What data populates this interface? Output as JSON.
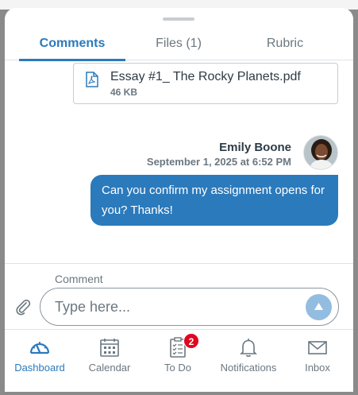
{
  "tabs": [
    {
      "label": "Comments",
      "active": true
    },
    {
      "label": "Files (1)",
      "active": false
    },
    {
      "label": "Rubric",
      "active": false
    }
  ],
  "attachment": {
    "icon": "pdf-file-icon",
    "filename": "Essay #1_ The Rocky Planets.pdf",
    "size": "46 KB"
  },
  "message": {
    "author": "Emily Boone",
    "timestamp": "September 1, 2025 at 6:52 PM",
    "text": "Can you confirm my assignment opens for you? Thanks!"
  },
  "composer": {
    "label": "Comment",
    "placeholder": "Type here...",
    "attach_icon": "paperclip-icon",
    "send_icon": "arrow-up-icon"
  },
  "nav": {
    "items": [
      {
        "label": "Dashboard",
        "icon": "dashboard-gauge-icon",
        "active": true
      },
      {
        "label": "Calendar",
        "icon": "calendar-icon",
        "active": false
      },
      {
        "label": "To Do",
        "icon": "clipboard-checklist-icon",
        "active": false,
        "badge": "2"
      },
      {
        "label": "Notifications",
        "icon": "bell-icon",
        "active": false
      },
      {
        "label": "Inbox",
        "icon": "envelope-icon",
        "active": false
      }
    ]
  },
  "colors": {
    "accent": "#2b7abc",
    "bubble": "#2b7abc",
    "badge": "#e0061f",
    "send_button": "#93bde0"
  }
}
